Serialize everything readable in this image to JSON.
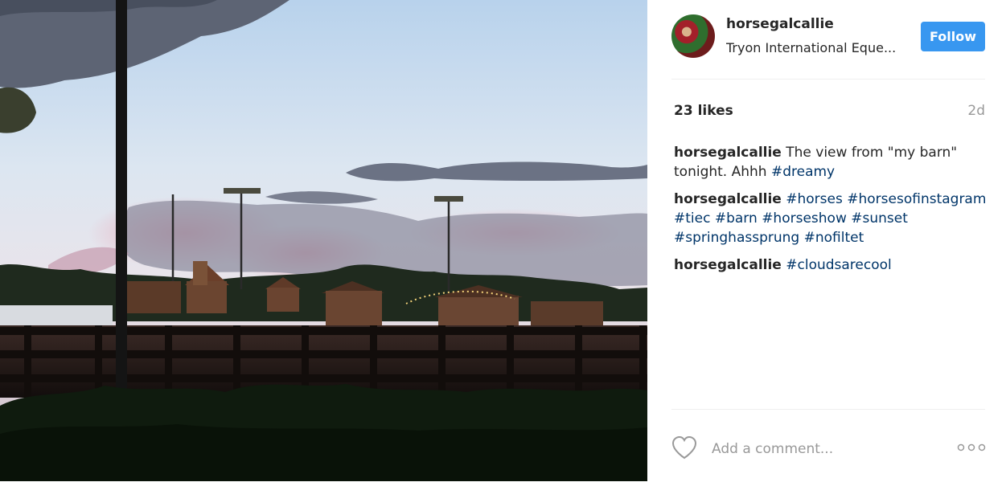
{
  "post": {
    "username": "horsegalcallie",
    "location": "Tryon International Eque...",
    "follow_label": "Follow",
    "likes": "23 likes",
    "time": "2d",
    "comments": [
      {
        "user": "horsegalcallie",
        "parts": [
          {
            "text": " The view from \"my barn\" tonight. Ahhh ",
            "tag": false
          },
          {
            "text": "#dreamy",
            "tag": true
          }
        ]
      },
      {
        "user": "horsegalcallie",
        "parts": [
          {
            "text": " ",
            "tag": false
          },
          {
            "text": "#horses",
            "tag": true
          },
          {
            "text": " ",
            "tag": false
          },
          {
            "text": "#horsesofinstagram",
            "tag": true
          },
          {
            "text": " ",
            "tag": false
          },
          {
            "text": "#tiec",
            "tag": true
          },
          {
            "text": " ",
            "tag": false
          },
          {
            "text": "#barn",
            "tag": true
          },
          {
            "text": " ",
            "tag": false
          },
          {
            "text": "#horseshow",
            "tag": true
          },
          {
            "text": " ",
            "tag": false
          },
          {
            "text": "#sunset",
            "tag": true
          },
          {
            "text": " ",
            "tag": false
          },
          {
            "text": "#springhassprung",
            "tag": true
          },
          {
            "text": " ",
            "tag": false
          },
          {
            "text": "#nofiltet",
            "tag": true
          }
        ]
      },
      {
        "user": "horsegalcallie",
        "parts": [
          {
            "text": " ",
            "tag": false
          },
          {
            "text": "#cloudsarecool",
            "tag": true
          }
        ]
      }
    ],
    "comment_placeholder": "Add a comment...",
    "icons": {
      "like": "heart-icon",
      "more": "more-options-icon"
    }
  },
  "colors": {
    "follow": "#3897f0",
    "hashtag": "#003569",
    "muted": "#999999"
  }
}
